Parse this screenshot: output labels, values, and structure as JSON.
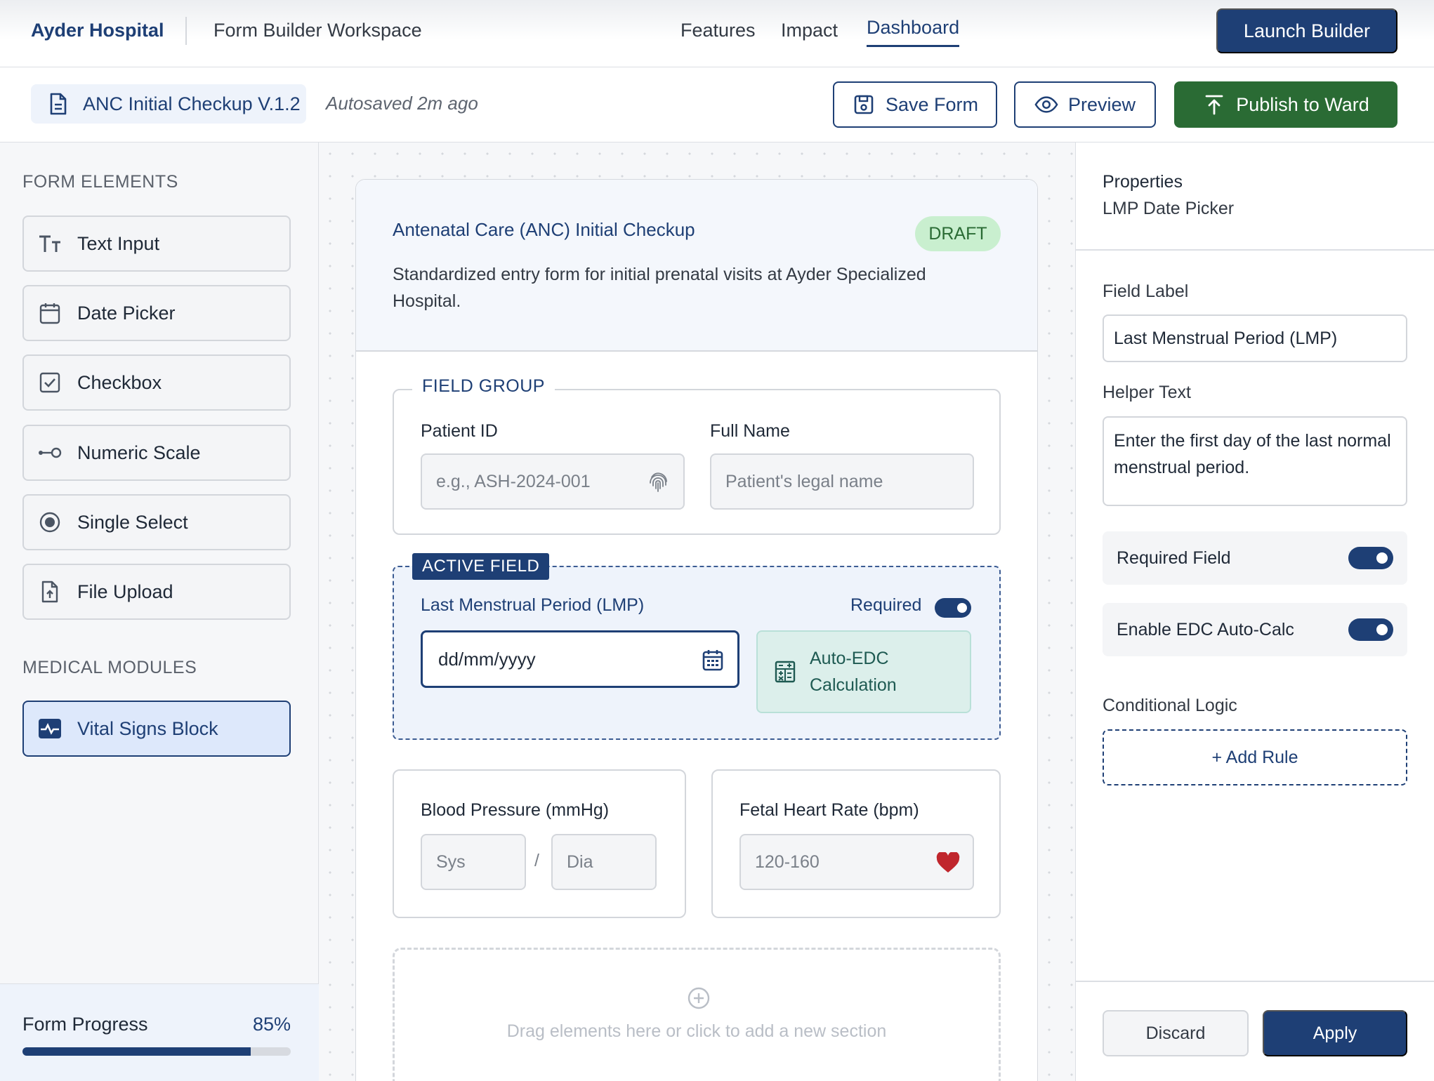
{
  "app": {
    "brand": "Ayder Hospital",
    "workspace": "Form Builder Workspace",
    "nav": [
      "Features",
      "Impact",
      "Dashboard"
    ],
    "active_nav": "Dashboard",
    "launch_button": "Launch Builder"
  },
  "toolbar": {
    "doc_title": "ANC Initial Checkup V.1.2",
    "autosave": "Autosaved 2m ago",
    "save_label": "Save Form",
    "preview_label": "Preview",
    "publish_label": "Publish to Ward"
  },
  "sidebar": {
    "form_elements_title": "FORM ELEMENTS",
    "elements": [
      {
        "label": "Text Input",
        "icon": "text-type-icon"
      },
      {
        "label": "Date Picker",
        "icon": "calendar-icon"
      },
      {
        "label": "Checkbox",
        "icon": "checkbox-icon"
      },
      {
        "label": "Numeric Scale",
        "icon": "slider-icon"
      },
      {
        "label": "Single Select",
        "icon": "radio-icon"
      },
      {
        "label": "File Upload",
        "icon": "file-upload-icon"
      }
    ],
    "modules_title": "MEDICAL MODULES",
    "modules": [
      {
        "label": "Vital Signs Block",
        "icon": "vitals-icon"
      }
    ],
    "progress_label": "Form Progress",
    "progress_value": "85%",
    "progress_fraction": 0.85
  },
  "form": {
    "title": "Antenatal Care (ANC) Initial Checkup",
    "status_badge": "DRAFT",
    "description": "Standardized entry form for initial prenatal visits at Ayder Specialized Hospital.",
    "field_group": {
      "legend": "FIELD GROUP",
      "patient_id_label": "Patient ID",
      "patient_id_placeholder": "e.g., ASH-2024-001",
      "full_name_label": "Full Name",
      "full_name_placeholder": "Patient's legal name"
    },
    "active_field": {
      "tag": "ACTIVE FIELD",
      "label": "Last Menstrual Period (LMP)",
      "required_label": "Required",
      "required": true,
      "date_placeholder": "dd/mm/yyyy",
      "edc_line1": "Auto-EDC",
      "edc_line2": "Calculation"
    },
    "blood_pressure": {
      "label": "Blood Pressure (mmHg)",
      "sys_placeholder": "Sys",
      "separator": "/",
      "dia_placeholder": "Dia"
    },
    "fetal_heart_rate": {
      "label": "Fetal Heart Rate (bpm)",
      "placeholder": "120-160"
    },
    "dropzone_text": "Drag elements here or click to add a new section"
  },
  "properties": {
    "title": "Properties",
    "subtitle": "LMP Date Picker",
    "field_label_title": "Field Label",
    "field_label_value": "Last Menstrual Period (LMP)",
    "helper_text_title": "Helper Text",
    "helper_text_value": "Enter the first day of the last normal menstrual period.",
    "required_field_label": "Required Field",
    "required_field_on": true,
    "edc_label": "Enable EDC Auto-Calc",
    "edc_on": true,
    "conditional_logic_title": "Conditional Logic",
    "add_rule_label": "+ Add Rule",
    "discard_label": "Discard",
    "apply_label": "Apply"
  },
  "colors": {
    "primary": "#1e3f75",
    "publish": "#2a6b34",
    "draft_bg": "#c9efcf",
    "heart": "#c0262d"
  }
}
